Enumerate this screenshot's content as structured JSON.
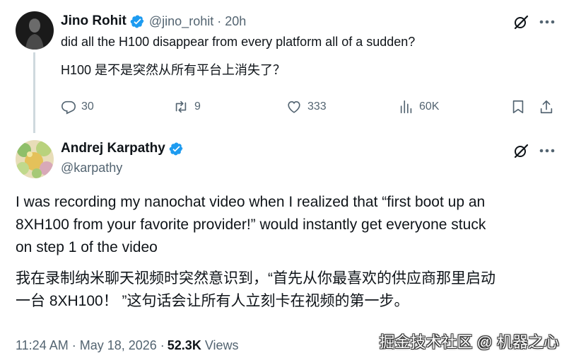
{
  "reply_tweet": {
    "author_name": "Jino Rohit",
    "handle": "@jino_rohit",
    "separator": "·",
    "time": "20h",
    "text_en": "did all the H100 disappear from every platform all of a sudden?",
    "text_zh": "H100 是不是突然从所有平台上消失了？",
    "replies": "30",
    "reposts": "9",
    "likes": "333",
    "views": "60K"
  },
  "main_tweet": {
    "author_name": "Andrej Karpathy",
    "handle": "@karpathy",
    "text_en_lines": [
      "I was recording my nanochat video when I realized that “first boot up an",
      "8XH100 from your favorite provider!” would instantly get everyone stuck",
      "on step 1 of the video"
    ],
    "text_zh_lines": [
      "我在录制纳米聊天视频时突然意识到，“首先从你最喜欢的供应商那里启动",
      "一台 8XH100！ ”这句话会让所有人立刻卡在视频的第一步。"
    ],
    "timestamp": "11:24 AM · May 18, 2026 ·",
    "views_count": "52.3K",
    "views_label": "Views"
  },
  "watermark": "掘金技术社区 @ 机器之心",
  "colors": {
    "verified": "#1d9bf0",
    "text_primary": "#0f1419",
    "text_secondary": "#536471",
    "thread_line": "#cfd9de"
  },
  "icons": [
    "verified-icon",
    "grok-icon",
    "more-icon",
    "reply-icon",
    "repost-icon",
    "like-icon",
    "views-icon",
    "bookmark-icon",
    "share-icon"
  ]
}
